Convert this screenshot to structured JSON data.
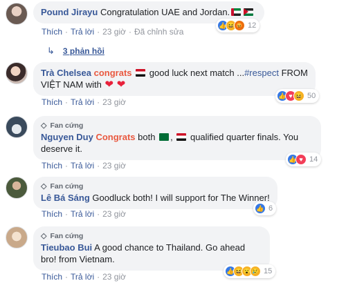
{
  "comments": [
    {
      "author": "Pound Jirayu",
      "fan_badge": "",
      "text_parts": [
        "Congratulation UAE and Jordan."
      ],
      "actions": {
        "like": "Thích",
        "reply": "Trả lời",
        "time": "23 giờ",
        "edited": "Đã chỉnh sửa"
      },
      "reactions": {
        "icons": [
          "like",
          "haha",
          "angry"
        ],
        "count": "12"
      }
    },
    {
      "author": "Trà Chelsea",
      "fan_badge": "",
      "tag": "congrats",
      "text_parts": [
        "good luck next match ...",
        "#respect",
        " FROM VIỆT NAM with"
      ],
      "actions": {
        "like": "Thích",
        "reply": "Trả lời",
        "time": "23 giờ"
      },
      "reactions": {
        "icons": [
          "like",
          "love",
          "haha"
        ],
        "count": "50"
      }
    },
    {
      "author": "Nguyen Duy",
      "fan_badge": "Fan cứng",
      "tag": "Congrats",
      "text_parts": [
        "both",
        ",",
        "qualified quarter finals. You deserve it."
      ],
      "actions": {
        "like": "Thích",
        "reply": "Trả lời",
        "time": "23 giờ"
      },
      "reactions": {
        "icons": [
          "like",
          "love"
        ],
        "count": "14"
      }
    },
    {
      "author": "Lê Bá Sáng",
      "fan_badge": "Fan cứng",
      "text_parts": [
        "Goodluck both! I will support for The Winner!"
      ],
      "actions": {
        "like": "Thích",
        "reply": "Trả lời",
        "time": "23 giờ"
      },
      "reactions": {
        "icons": [
          "like"
        ],
        "count": "6"
      }
    },
    {
      "author": "Tieubao Bui",
      "fan_badge": "Fan cứng",
      "text_parts": [
        "A good chance to Thailand. Go ahead bro! from Vietnam."
      ],
      "actions": {
        "like": "Thích",
        "reply": "Trả lời",
        "time": "23 giờ"
      },
      "reactions": {
        "icons": [
          "like",
          "haha",
          "wow",
          "sad"
        ],
        "count": "15"
      }
    }
  ],
  "replies_link": "3 phản hồi",
  "colors": {
    "link": "#385898",
    "tag": "#e9583f",
    "bubble": "#f2f3f5",
    "like": "#3578e5",
    "love": "#f33e58"
  }
}
